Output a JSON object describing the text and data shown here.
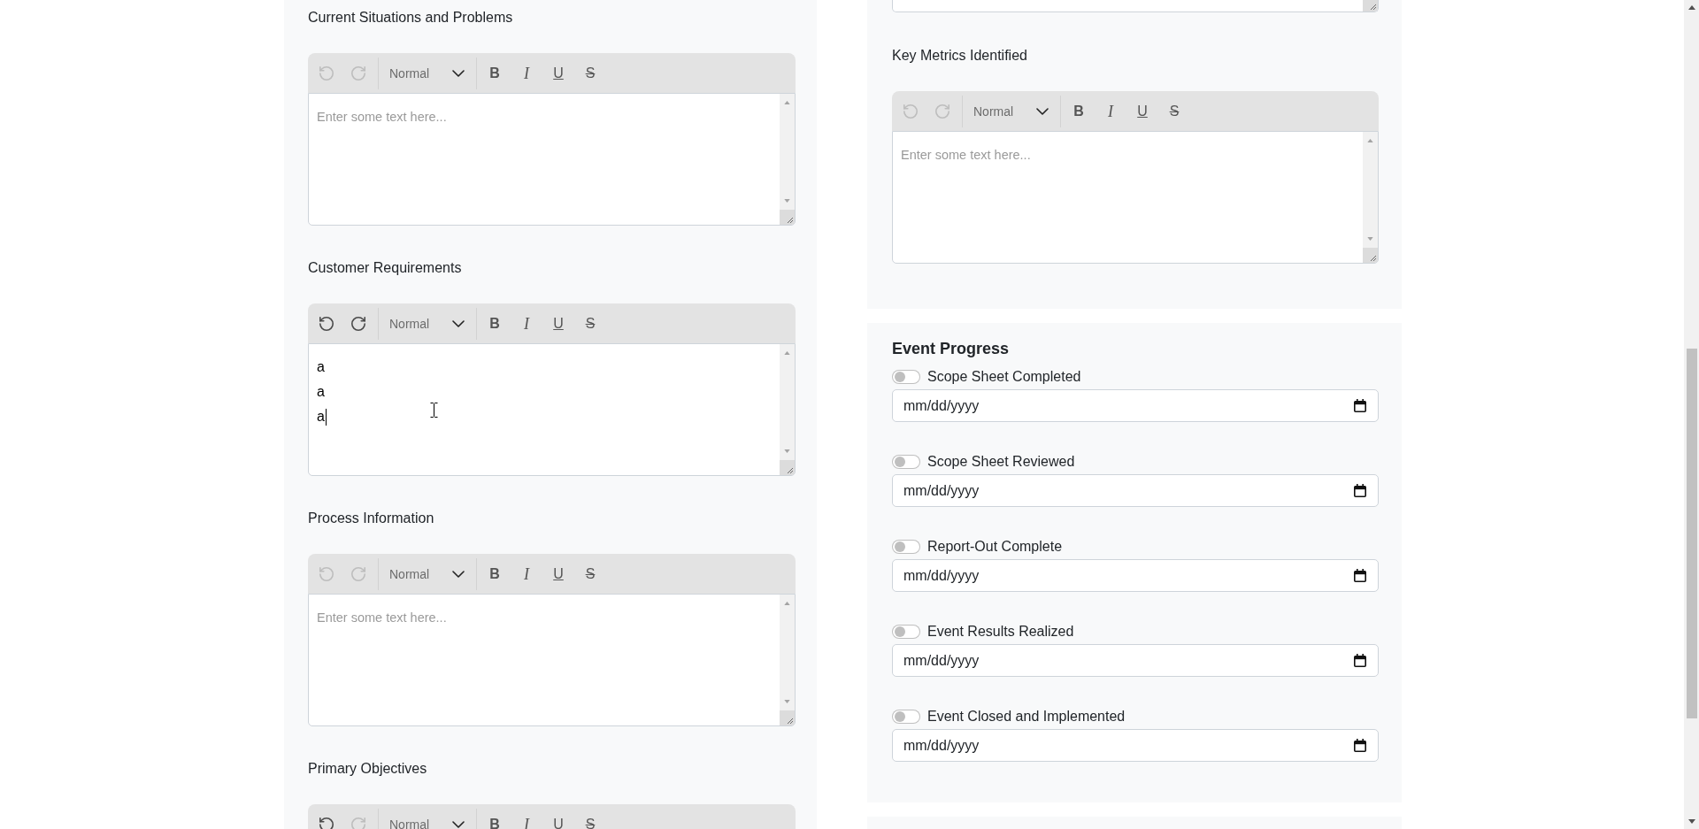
{
  "left_column": {
    "editors": [
      {
        "label": "Current Situations and Problems",
        "toolbar": {
          "history": [
            {
              "kind": "undo",
              "disabled": true
            },
            {
              "kind": "redo",
              "disabled": true
            }
          ],
          "block_format": "Normal",
          "formats": [
            {
              "kind": "bold",
              "label": "B"
            },
            {
              "kind": "italic",
              "label": "I"
            },
            {
              "kind": "underline",
              "label": "U"
            },
            {
              "kind": "strike",
              "label": "S"
            }
          ]
        },
        "placeholder": "Enter some text here...",
        "focused": false
      },
      {
        "label": "Customer Requirements",
        "toolbar": {
          "history": [
            {
              "kind": "undo",
              "disabled": false
            },
            {
              "kind": "redo",
              "disabled": false
            }
          ],
          "block_format": "Normal",
          "formats": [
            {
              "kind": "bold",
              "label": "B"
            },
            {
              "kind": "italic",
              "label": "I"
            },
            {
              "kind": "underline",
              "label": "U"
            },
            {
              "kind": "strike",
              "label": "S"
            }
          ]
        },
        "lines": [
          "a",
          "a",
          "a"
        ],
        "focused": true
      },
      {
        "label": "Process Information",
        "toolbar": {
          "history": [
            {
              "kind": "undo",
              "disabled": true
            },
            {
              "kind": "redo",
              "disabled": true
            }
          ],
          "block_format": "Normal",
          "formats": [
            {
              "kind": "bold",
              "label": "B"
            },
            {
              "kind": "italic",
              "label": "I"
            },
            {
              "kind": "underline",
              "label": "U"
            },
            {
              "kind": "strike",
              "label": "S"
            }
          ]
        },
        "placeholder": "Enter some text here...",
        "focused": false
      },
      {
        "label": "Primary Objectives",
        "toolbar": {
          "history": [
            {
              "kind": "undo",
              "disabled": false
            },
            {
              "kind": "redo",
              "disabled": true
            }
          ],
          "block_format": "Normal",
          "formats": [
            {
              "kind": "bold",
              "label": "B"
            },
            {
              "kind": "italic",
              "label": "I"
            },
            {
              "kind": "underline",
              "label": "U"
            },
            {
              "kind": "strike",
              "label": "S"
            }
          ]
        }
      }
    ]
  },
  "right_column": {
    "metrics_editor": {
      "label": "Key Metrics Identified",
      "toolbar": {
        "history": [
          {
            "kind": "undo",
            "disabled": true
          },
          {
            "kind": "redo",
            "disabled": true
          }
        ],
        "block_format": "Normal",
        "formats": [
          {
            "kind": "bold",
            "label": "B"
          },
          {
            "kind": "italic",
            "label": "I"
          },
          {
            "kind": "underline",
            "label": "U"
          },
          {
            "kind": "strike",
            "label": "S"
          }
        ]
      },
      "placeholder": "Enter some text here...",
      "focused": false
    },
    "event_progress": {
      "title": "Event Progress",
      "steps": [
        {
          "label": "Scope Sheet Completed",
          "on": false,
          "date_field": {
            "placeholder": "mm/dd/yyyy"
          }
        },
        {
          "label": "Scope Sheet Reviewed",
          "on": false,
          "date_field": {
            "placeholder": "mm/dd/yyyy"
          }
        },
        {
          "label": "Report-Out Complete",
          "on": false,
          "date_field": {
            "placeholder": "mm/dd/yyyy"
          }
        },
        {
          "label": "Event Results Realized",
          "on": false,
          "date_field": {
            "placeholder": "mm/dd/yyyy"
          }
        },
        {
          "label": "Event Closed and Implemented",
          "on": false,
          "date_field": {
            "placeholder": "mm/dd/yyyy"
          }
        }
      ]
    }
  }
}
